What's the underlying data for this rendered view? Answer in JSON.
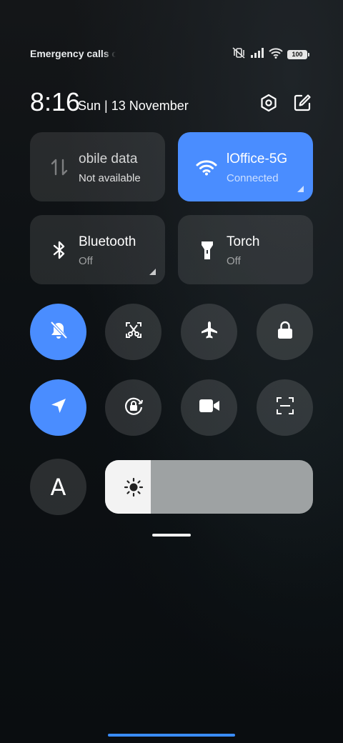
{
  "status_bar": {
    "carrier_text": "Emergency calls o",
    "battery_level": "100",
    "icons": [
      "vibrate-off-icon",
      "signal-icon",
      "wifi-icon",
      "battery-icon"
    ]
  },
  "header": {
    "time": "8:16",
    "date": "Sun | 13 November",
    "settings_icon": "settings-icon",
    "edit_icon": "edit-icon"
  },
  "tiles": [
    {
      "title": "obile data",
      "subtitle": "Not available",
      "active": false,
      "icon": "mobile-data-icon"
    },
    {
      "title": "lOffice-5G",
      "subtitle": "Connected",
      "active": true,
      "icon": "wifi-icon"
    },
    {
      "title": "Bluetooth",
      "subtitle": "Off",
      "active": false,
      "icon": "bluetooth-icon"
    },
    {
      "title": "Torch",
      "subtitle": "Off",
      "active": false,
      "icon": "torch-icon"
    }
  ],
  "toggles": [
    {
      "icon": "silent-bell-icon",
      "active": true
    },
    {
      "icon": "screenshot-icon",
      "active": false
    },
    {
      "icon": "airplane-icon",
      "active": false
    },
    {
      "icon": "lock-icon",
      "active": false
    },
    {
      "icon": "location-icon",
      "active": true
    },
    {
      "icon": "rotation-lock-icon",
      "active": false
    },
    {
      "icon": "screen-record-icon",
      "active": false
    },
    {
      "icon": "scanner-icon",
      "active": false
    }
  ],
  "auto_brightness": {
    "label": "A"
  },
  "brightness": {
    "level_percent": 22,
    "icon": "sun-icon"
  },
  "colors": {
    "accent": "#4a8dff",
    "tile_bg": "#2b3033",
    "slider_track": "#9ea2a3",
    "slider_fill": "#f3f3f3"
  }
}
